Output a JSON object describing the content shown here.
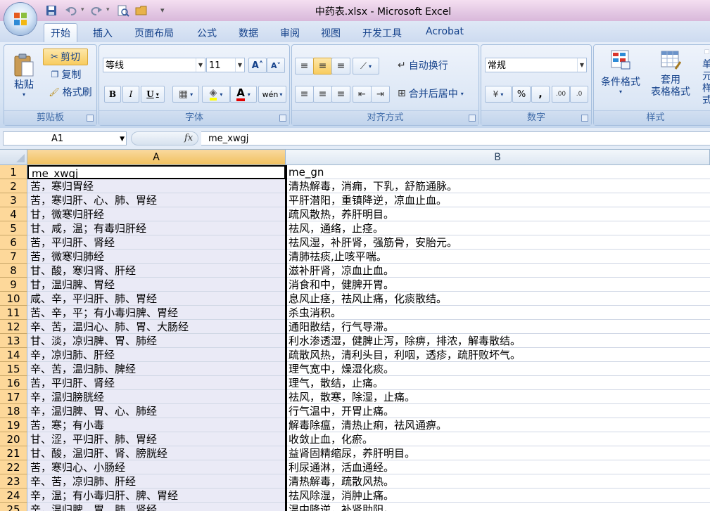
{
  "window": {
    "title": "中药表.xlsx - Microsoft Excel"
  },
  "tabs": [
    "开始",
    "插入",
    "页面布局",
    "公式",
    "数据",
    "审阅",
    "视图",
    "开发工具",
    "Acrobat"
  ],
  "clipboard": {
    "paste": "粘贴",
    "cut": "剪切",
    "copy": "复制",
    "format_painter": "格式刷",
    "label": "剪贴板"
  },
  "font": {
    "name": "等线",
    "size": "11",
    "label": "字体"
  },
  "alignment": {
    "wrap_text": "自动换行",
    "merge_center": "合并后居中",
    "label": "对齐方式"
  },
  "number": {
    "format": "常规",
    "label": "数字"
  },
  "styles": {
    "conditional_format": "条件格式",
    "format_as_table_1": "套用",
    "format_as_table_2": "表格格式",
    "cell_styles_1": "单元",
    "cell_styles_2": "样式",
    "label": "样式"
  },
  "formula_bar": {
    "name_box": "A1",
    "fx": "fx",
    "formula": "me_xwgj"
  },
  "columns": [
    "A",
    "B"
  ],
  "rows": [
    {
      "n": "1",
      "a": "me_xwgj",
      "b": "me_gn"
    },
    {
      "n": "2",
      "a": "苦，寒归胃经",
      "b": "清热解毒，消痈，下乳，舒筋通脉。"
    },
    {
      "n": "3",
      "a": "苦，寒归肝、心、肺、胃经",
      "b": "平肝潜阳，重镇降逆，凉血止血。"
    },
    {
      "n": "4",
      "a": "甘，微寒归肝经",
      "b": "疏风散热，养肝明目。"
    },
    {
      "n": "5",
      "a": "甘、咸，温；有毒归肝经",
      "b": "祛风，通络，止痉。"
    },
    {
      "n": "6",
      "a": "苦，平归肝、肾经",
      "b": "祛风湿，补肝肾，强筋骨，安胎元。"
    },
    {
      "n": "7",
      "a": "苦，微寒归肺经",
      "b": "清肺祛痰,止咳平喘。"
    },
    {
      "n": "8",
      "a": "甘、酸，寒归肾、肝经",
      "b": "滋补肝肾，凉血止血。"
    },
    {
      "n": "9",
      "a": "甘，温归脾、胃经",
      "b": "消食和中，健脾开胃。"
    },
    {
      "n": "10",
      "a": "咸、辛，平归肝、肺、胃经",
      "b": "息风止痉，祛风止痛，化痰散结。"
    },
    {
      "n": "11",
      "a": "苦、辛，平；有小毒归脾、胃经",
      "b": "杀虫消积。"
    },
    {
      "n": "12",
      "a": "辛、苦，温归心、肺、胃、大肠经",
      "b": "通阳散结，行气导滞。"
    },
    {
      "n": "13",
      "a": "甘、淡，凉归脾、胃、肺经",
      "b": "利水渗透湿，健脾止泻，除痹，排浓，解毒散结。"
    },
    {
      "n": "14",
      "a": "辛，凉归肺、肝经",
      "b": "疏散风热，清利头目，利咽，透疹，疏肝败坏气。"
    },
    {
      "n": "15",
      "a": "辛、苦，温归肺、脾经",
      "b": "理气宽中，燥湿化痰。"
    },
    {
      "n": "16",
      "a": "苦，平归肝、肾经",
      "b": "理气，散结，止痛。"
    },
    {
      "n": "17",
      "a": "辛，温归膀胱经",
      "b": "祛风，散寒，除湿，止痛。"
    },
    {
      "n": "18",
      "a": "辛，温归脾、胃、心、肺经",
      "b": "行气温中，开胃止痛。"
    },
    {
      "n": "19",
      "a": "苦，寒；有小毒",
      "b": "解毒除瘟，清热止痢，祛风通痹。"
    },
    {
      "n": "20",
      "a": "甘、涩，平归肝、肺、胃经",
      "b": "收敛止血，化瘀。"
    },
    {
      "n": "21",
      "a": "甘、酸，温归肝、肾、膀胱经",
      "b": "益肾固精缩尿，养肝明目。"
    },
    {
      "n": "22",
      "a": "苦，寒归心、小肠经",
      "b": "利尿通淋，活血通经。"
    },
    {
      "n": "23",
      "a": "辛、苦，凉归肺、肝经",
      "b": "清热解毒，疏散风热。"
    },
    {
      "n": "24",
      "a": "辛，温；有小毒归肝、脾、胃经",
      "b": "祛风除湿，消肿止痛。"
    },
    {
      "n": "25",
      "a": "辛，温归脾、胃、肺、肾经",
      "b": "温中降逆，补肾助阳。"
    }
  ]
}
